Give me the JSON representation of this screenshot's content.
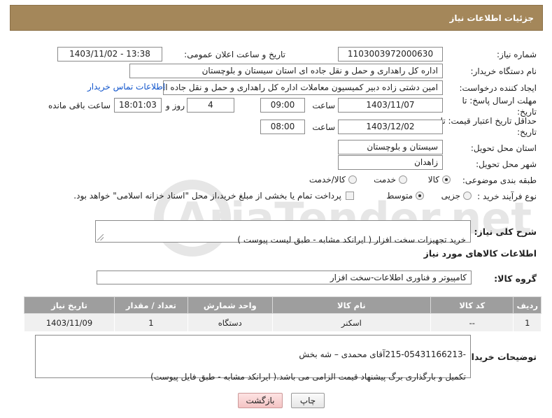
{
  "header": {
    "title": "جزئیات اطلاعات نیاز"
  },
  "form": {
    "need_number": {
      "label": "شماره نیاز:",
      "value": "1103003972000630"
    },
    "announce_datetime": {
      "label": "تاریخ و ساعت اعلان عمومی:",
      "value": "1403/11/02 - 13:38"
    },
    "buyer_org": {
      "label": "نام دستگاه خریدار:",
      "value": "اداره کل راهداری و حمل و نقل جاده ای استان سیستان و بلوچستان"
    },
    "requester": {
      "label": "ایجاد کننده درخواست:",
      "value": "امین دشتی زاده دبیر کمیسیون معاملات اداره کل راهداری و حمل و نقل جاده ای",
      "contact_link": "اطلاعات تماس خریدار"
    },
    "reply_deadline": {
      "label_line1": "مهلت ارسال پاسخ: تا",
      "label_line2": "تاریخ:",
      "date": "1403/11/07",
      "time_label": "ساعت",
      "time": "09:00",
      "days": "4",
      "days_label": "روز و",
      "remaining_time": "18:01:03",
      "remaining_label": "ساعت باقی مانده"
    },
    "price_validity": {
      "label_line1": "حداقل تاریخ اعتبار قیمت: تا",
      "label_line2": "تاریخ:",
      "date": "1403/12/02",
      "time_label": "ساعت",
      "time": "08:00"
    },
    "delivery_province": {
      "label": "استان محل تحویل:",
      "value": "سیستان و بلوچستان"
    },
    "delivery_city": {
      "label": "شهر محل تحویل:",
      "value": "زاهدان"
    },
    "category": {
      "label": "طبقه بندی موضوعی:",
      "options": [
        "کالا",
        "خدمت",
        "کالا/خدمت"
      ],
      "selected": "کالا"
    },
    "purchase_type": {
      "label": "نوع فرآیند خرید :",
      "options": [
        "جزیی",
        "متوسط"
      ],
      "selected": "متوسط",
      "payment_note": "پرداخت تمام یا بخشی از مبلغ خرید،از محل \"اسناد خزانه اسلامی\" خواهد بود."
    }
  },
  "description": {
    "label": "شرح کلی نیاز:",
    "value": "خرید تجهیزات سخت افزار ( ایرانکد مشابه - طبق لیست پیوست )"
  },
  "goods_section": {
    "title": "اطلاعات کالاهای مورد نیاز"
  },
  "goods_group": {
    "label": "گروه کالا:",
    "value": "کامپیوتر و فناوری اطلاعات-سخت افزار"
  },
  "items_table": {
    "columns": [
      "ردیف",
      "کد کالا",
      "نام کالا",
      "واحد شمارش",
      "تعداد / مقدار",
      "تاریخ نیاز"
    ],
    "rows": [
      [
        "1",
        "--",
        "اسکنر",
        "دستگاه",
        "1",
        "1403/11/09"
      ]
    ]
  },
  "buyer_notes": {
    "label": "توضیحات خریدار:",
    "line1": "-215-05431166213آقای محمدی – شه بخش",
    "line2": "تکمیل و بارگذاری برگ پیشنهاد قیمت الزامی می باشد.( ایرانکد مشابه - طبق فایل پیوست)"
  },
  "actions": {
    "print_label": "چاپ",
    "back_label": "بازگشت"
  },
  "watermark": {
    "text": "AriaTender.net"
  },
  "colors": {
    "header": "#a4875a",
    "table_header": "#9e9e9e",
    "link": "#1155cc"
  }
}
